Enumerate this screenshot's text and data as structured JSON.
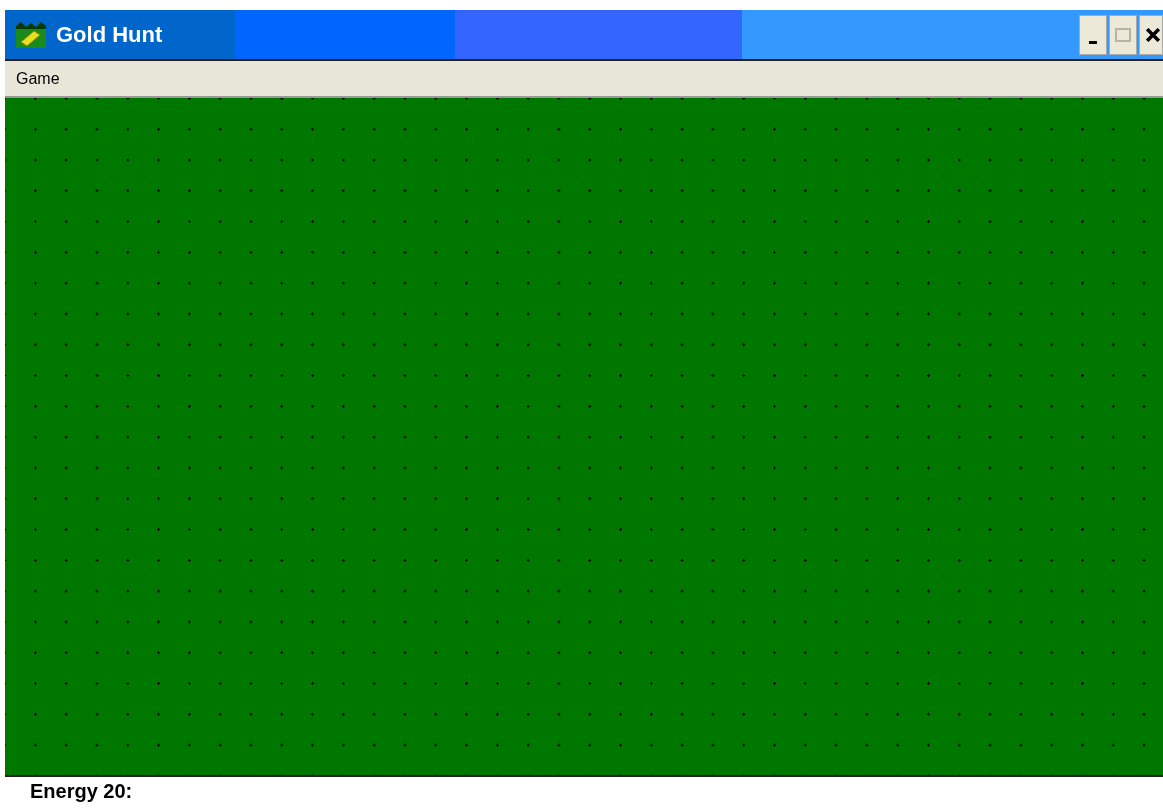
{
  "window": {
    "title": "Gold Hunt"
  },
  "menu": [
    {
      "label": "Game"
    }
  ],
  "status_bar": {
    "text": "Energy 20:"
  }
}
